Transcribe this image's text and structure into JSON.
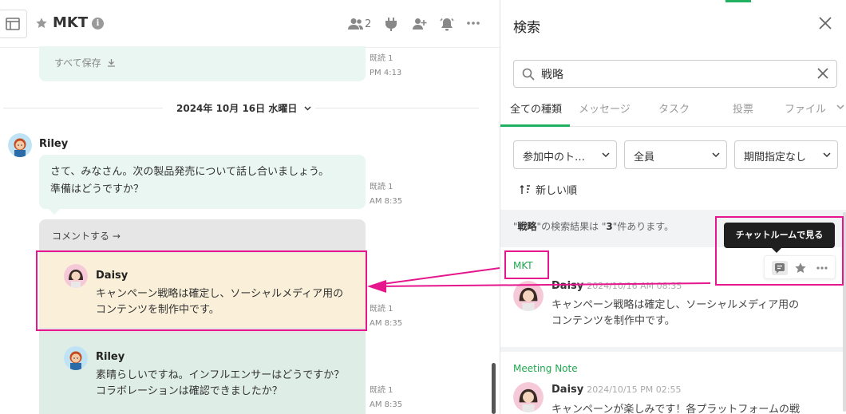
{
  "header": {
    "room_title": "MKT",
    "members_count": "2"
  },
  "messages": {
    "top": {
      "save_all": "すべて保存",
      "read": "既読 1",
      "time": "PM 4:13"
    },
    "date_separator": "2024年 10月 16日 水曜日",
    "riley_main": {
      "sender": "Riley",
      "text_line1": "さて、みなさん。次の製品発売について話し合いましょう。",
      "text_line2": "準備はどうですか？",
      "read": "既読 1",
      "time": "AM 8:35"
    },
    "comment_link": "コメントする →",
    "daisy_reply": {
      "sender": "Daisy",
      "text_line1": "キャンペーン戦略は確定し、ソーシャルメディア用の",
      "text_line2": "コンテンツを制作中です。",
      "read": "既読 1",
      "time": "AM 8:35"
    },
    "riley_reply": {
      "sender": "Riley",
      "text_line1": "素晴らしいですね。インフルエンサーはどうですか？",
      "text_line2": "コラボレーションは確認できましたか？",
      "read": "既読 1",
      "time": "AM 8:35"
    }
  },
  "search": {
    "title": "検索",
    "query": "戦略",
    "tabs": [
      {
        "label": "全ての種類"
      },
      {
        "label": "メッセージ"
      },
      {
        "label": "タスク"
      },
      {
        "label": "投票"
      },
      {
        "label": "ファイル"
      }
    ],
    "filters": {
      "room": "参加中のト…",
      "member": "全員",
      "period": "期間指定なし"
    },
    "sort_label": "新しい順",
    "result_summary": {
      "prefix": "\"",
      "keyword": "戦略",
      "middle": "\"の検索結果は \"",
      "count": "3",
      "suffix": "\"件あります。"
    },
    "tooltip": "チャットルームで見る",
    "results": [
      {
        "room": "MKT",
        "sender": "Daisy",
        "date": "2024/10/16 AM 08:35",
        "line1": "キャンペーン戦略は確定し、ソーシャルメディア用の",
        "line2": "コンテンツを制作中です。"
      },
      {
        "room": "Meeting Note",
        "sender": "Daisy",
        "date": "2024/10/15 PM 02:55",
        "line1": "キャンペーンが楽しみです！各プラットフォームの戦"
      }
    ]
  },
  "colors": {
    "accent_green": "#20b060",
    "annotation_pink": "#e6168c",
    "mint_bubble": "#eaf6f1",
    "highlight_bubble": "#faf0d9"
  }
}
